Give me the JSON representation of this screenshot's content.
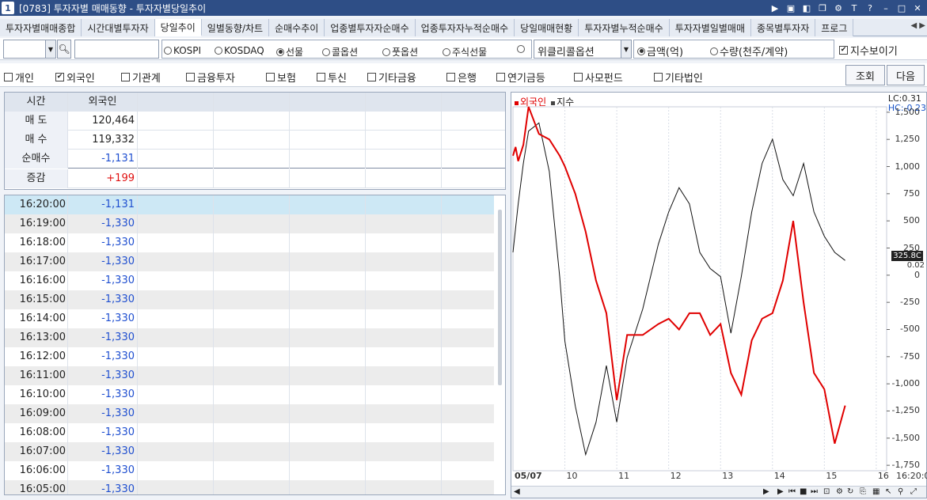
{
  "window": {
    "number": "1",
    "title": "[0783] 투자자별 매매동향 - 투자자별당일추이"
  },
  "tabs": [
    {
      "label": "투자자별매매종합"
    },
    {
      "label": "시간대별투자자"
    },
    {
      "label": "당일추이"
    },
    {
      "label": "일별동향/차트"
    },
    {
      "label": "순매수추이"
    },
    {
      "label": "업종별투자자순매수"
    },
    {
      "label": "업종투자자누적순매수"
    },
    {
      "label": "당일매매현황"
    },
    {
      "label": "투자자별누적순매수"
    },
    {
      "label": "투자자별일별매매"
    },
    {
      "label": "종목별투자자"
    },
    {
      "label": "프로그"
    }
  ],
  "filters": {
    "market_radios": [
      "KOSPI",
      "KOSDAQ",
      "선물",
      "콜옵션",
      "풋옵션",
      "주식선물"
    ],
    "market_selected": "선물",
    "option_select": "위클리콜옵션",
    "unit_radios": [
      "금액(억)",
      "수량(천주/계약)"
    ],
    "unit_selected": "금액(억)",
    "show_index_label": "지수보이기"
  },
  "investors": [
    {
      "label": "개인",
      "checked": false
    },
    {
      "label": "외국인",
      "checked": true
    },
    {
      "label": "기관계",
      "checked": false
    },
    {
      "label": "금융투자",
      "checked": false
    },
    {
      "label": "보험",
      "checked": false
    },
    {
      "label": "투신",
      "checked": false
    },
    {
      "label": "기타금융",
      "checked": false
    },
    {
      "label": "은행",
      "checked": false
    },
    {
      "label": "연기금등",
      "checked": false
    },
    {
      "label": "사모펀드",
      "checked": false
    },
    {
      "label": "기타법인",
      "checked": false
    }
  ],
  "buttons": {
    "search": "조회",
    "next": "다음"
  },
  "summary": {
    "header": {
      "time": "시간",
      "col": "외국인"
    },
    "rows": [
      {
        "label": "매 도",
        "value": "120,464",
        "tone": ""
      },
      {
        "label": "매 수",
        "value": "119,332",
        "tone": ""
      },
      {
        "label": "순매수",
        "value": "-1,131",
        "tone": "blue"
      },
      {
        "label": "증감",
        "value": "+199",
        "tone": "red"
      }
    ]
  },
  "timeseries": [
    {
      "time": "16:20:00",
      "value": "-1,131"
    },
    {
      "time": "16:19:00",
      "value": "-1,330"
    },
    {
      "time": "16:18:00",
      "value": "-1,330"
    },
    {
      "time": "16:17:00",
      "value": "-1,330"
    },
    {
      "time": "16:16:00",
      "value": "-1,330"
    },
    {
      "time": "16:15:00",
      "value": "-1,330"
    },
    {
      "time": "16:14:00",
      "value": "-1,330"
    },
    {
      "time": "16:13:00",
      "value": "-1,330"
    },
    {
      "time": "16:12:00",
      "value": "-1,330"
    },
    {
      "time": "16:11:00",
      "value": "-1,330"
    },
    {
      "time": "16:10:00",
      "value": "-1,330"
    },
    {
      "time": "16:09:00",
      "value": "-1,330"
    },
    {
      "time": "16:08:00",
      "value": "-1,330"
    },
    {
      "time": "16:07:00",
      "value": "-1,330"
    },
    {
      "time": "16:06:00",
      "value": "-1,330"
    },
    {
      "time": "16:05:00",
      "value": "-1,330"
    }
  ],
  "colors": {
    "foreign": "#e00000",
    "index": "#111111",
    "accent": "#2e4e86"
  },
  "chart_data": {
    "type": "line",
    "legend": [
      "외국인",
      "지수"
    ],
    "lc_label": "LC:0.31",
    "hc_label": "HC:-0.23",
    "current_value_label": "325.8C",
    "zero_pct_label": "0.02",
    "yticks": [
      "1,500",
      "1,250",
      "1,000",
      "750",
      "500",
      "250",
      "0",
      "-250",
      "-500",
      "-750",
      "-1,000",
      "-1,250",
      "-1,500",
      "-1,750"
    ],
    "ylim": [
      -1800,
      1550
    ],
    "xticks": [
      "05/07",
      "10",
      "11",
      "12",
      "13",
      "14",
      "15",
      "16",
      "16:20:0"
    ],
    "x": [
      9.0,
      9.05,
      9.1,
      9.2,
      9.3,
      9.5,
      9.7,
      9.9,
      10.0,
      10.2,
      10.4,
      10.6,
      10.8,
      11.0,
      11.2,
      11.5,
      11.8,
      12.0,
      12.2,
      12.4,
      12.6,
      12.8,
      13.0,
      13.2,
      13.4,
      13.6,
      13.8,
      14.0,
      14.2,
      14.4,
      14.6,
      14.8,
      15.0,
      15.2,
      15.4
    ],
    "series": [
      {
        "name": "외국인",
        "values": [
          1100,
          1180,
          1050,
          1200,
          1550,
          1300,
          1250,
          1100,
          1000,
          750,
          400,
          -50,
          -350,
          -1150,
          -550,
          -550,
          -450,
          -400,
          -500,
          -350,
          -350,
          -550,
          -450,
          -900,
          -1100,
          -600,
          -400,
          -350,
          -50,
          500,
          -250,
          -900,
          -1050,
          -1550,
          -1200
        ]
      },
      {
        "name": "지수",
        "values": [
          0.5,
          0.8,
          1.1,
          1.6,
          2.0,
          2.1,
          1.5,
          0.2,
          -0.6,
          -1.4,
          -2.0,
          -1.6,
          -0.9,
          -1.6,
          -0.8,
          -0.2,
          0.6,
          1.0,
          1.3,
          1.1,
          0.5,
          0.3,
          0.2,
          -0.5,
          0.2,
          1.0,
          1.6,
          1.9,
          1.4,
          1.2,
          1.6,
          1.0,
          0.7,
          0.5,
          0.4
        ]
      }
    ]
  }
}
